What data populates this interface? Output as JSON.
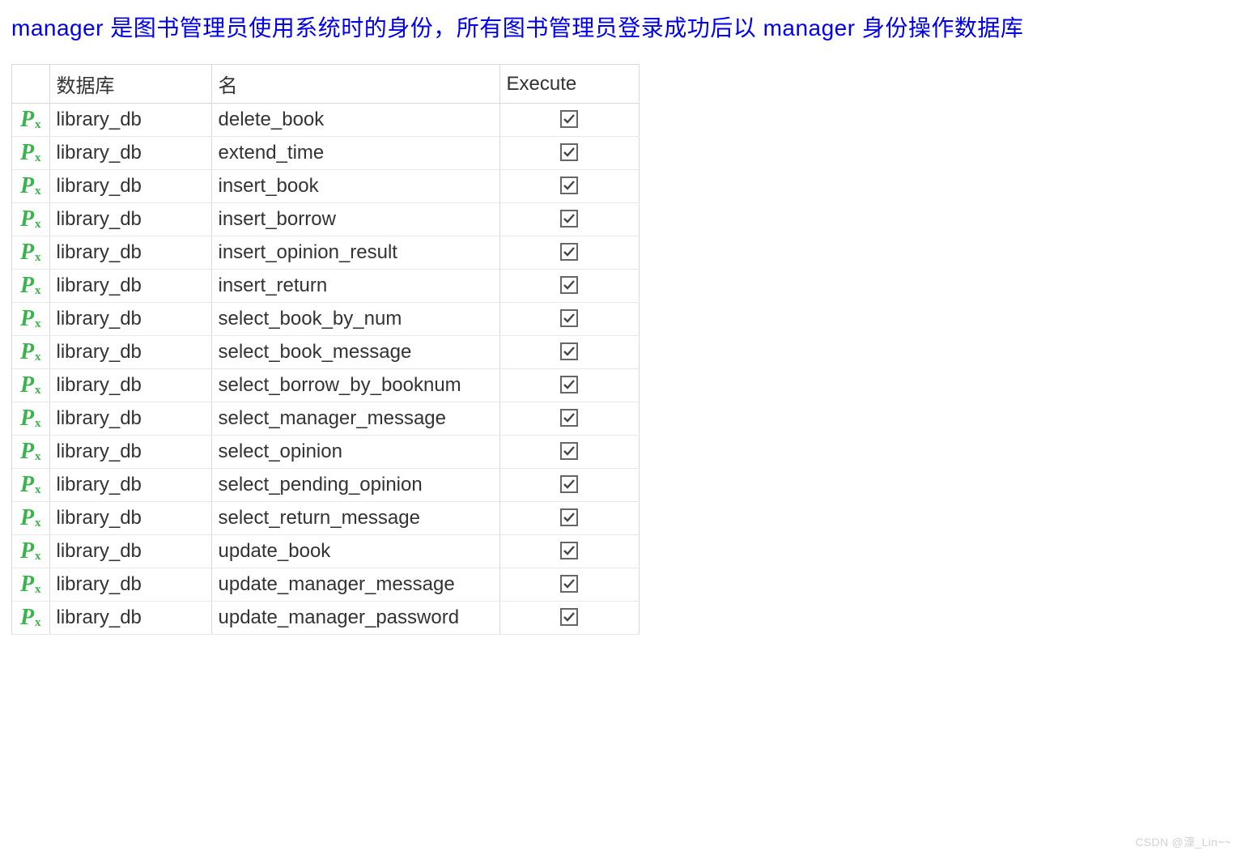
{
  "description": "manager 是图书管理员使用系统时的身份，所有图书管理员登录成功后以 manager 身份操作数据库",
  "table": {
    "headers": {
      "database": "数据库",
      "name": "名",
      "execute": "Execute"
    },
    "rows": [
      {
        "database": "library_db",
        "name": "delete_book",
        "execute": true
      },
      {
        "database": "library_db",
        "name": "extend_time",
        "execute": true
      },
      {
        "database": "library_db",
        "name": "insert_book",
        "execute": true
      },
      {
        "database": "library_db",
        "name": "insert_borrow",
        "execute": true
      },
      {
        "database": "library_db",
        "name": "insert_opinion_result",
        "execute": true
      },
      {
        "database": "library_db",
        "name": "insert_return",
        "execute": true
      },
      {
        "database": "library_db",
        "name": "select_book_by_num",
        "execute": true
      },
      {
        "database": "library_db",
        "name": "select_book_message",
        "execute": true
      },
      {
        "database": "library_db",
        "name": "select_borrow_by_booknum",
        "execute": true
      },
      {
        "database": "library_db",
        "name": "select_manager_message",
        "execute": true
      },
      {
        "database": "library_db",
        "name": "select_opinion",
        "execute": true
      },
      {
        "database": "library_db",
        "name": "select_pending_opinion",
        "execute": true
      },
      {
        "database": "library_db",
        "name": "select_return_message",
        "execute": true
      },
      {
        "database": "library_db",
        "name": "update_book",
        "execute": true
      },
      {
        "database": "library_db",
        "name": "update_manager_message",
        "execute": true
      },
      {
        "database": "library_db",
        "name": "update_manager_password",
        "execute": true
      }
    ]
  },
  "watermark": "CSDN @澟_Lin~~"
}
